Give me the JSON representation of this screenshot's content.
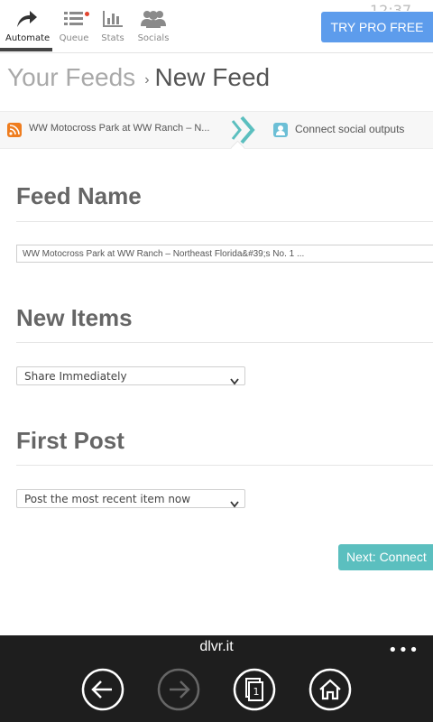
{
  "topnav": {
    "items": [
      {
        "label": "Automate",
        "icon": "share-arrow-icon",
        "active": true
      },
      {
        "label": "Queue",
        "icon": "list-icon",
        "has_notification": true
      },
      {
        "label": "Stats",
        "icon": "bar-chart-icon"
      },
      {
        "label": "Socials",
        "icon": "people-icon"
      }
    ],
    "clock": "12:37",
    "pro_label": "TRY PRO FREE"
  },
  "breadcrumb": {
    "prev": "Your Feeds",
    "sep": "›",
    "current": "New Feed"
  },
  "steps": {
    "step1": "WW Motocross Park at WW Ranch – N...",
    "step2": "Connect social outputs"
  },
  "form": {
    "feed_name_heading": "Feed Name",
    "feed_name_value": "WW Motocross Park at WW Ranch – Northeast Florida&#39;s No. 1 ...",
    "new_items_heading": "New Items",
    "new_items_value": "Share Immediately",
    "first_post_heading": "First Post",
    "first_post_value": "Post the most recent item now",
    "next_label": "Next: Connect"
  },
  "browser": {
    "url": "dlvr.it",
    "more": "•••",
    "tab_count": "1"
  },
  "colors": {
    "accent_blue": "#5d9cec",
    "teal": "#5bbfbf",
    "rss_orange": "#ef7d1f",
    "notify_red": "#e2452f"
  }
}
